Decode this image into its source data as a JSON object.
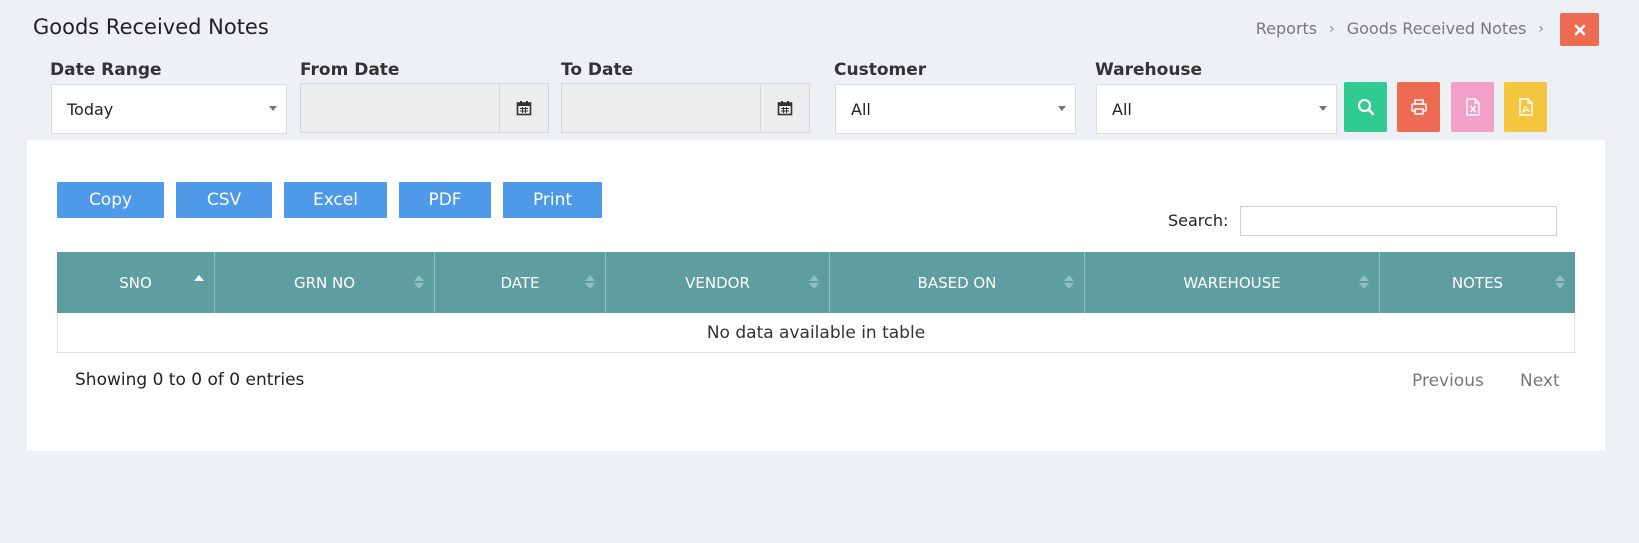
{
  "header": {
    "title": "Goods Received Notes",
    "breadcrumb": [
      "Reports",
      "Goods Received Notes"
    ],
    "breadcrumb_sep": "›"
  },
  "filters": {
    "date_range": {
      "label": "Date Range",
      "value": "Today"
    },
    "from_date": {
      "label": "From Date",
      "value": ""
    },
    "to_date": {
      "label": "To Date",
      "value": ""
    },
    "customer": {
      "label": "Customer",
      "value": "All"
    },
    "warehouse": {
      "label": "Warehouse",
      "value": "All"
    }
  },
  "actions": {
    "search_icon": "search-icon",
    "print_icon": "printer-icon",
    "excel_icon": "excel-file-icon",
    "pdf_icon": "pdf-file-icon"
  },
  "colors": {
    "close": "#ef6a52",
    "search": "#2fcb93",
    "print": "#ef6a52",
    "excel": "#f2a0c8",
    "pdf": "#f4c63f",
    "export": "#4f9ae8",
    "table_head": "#5f9ea0"
  },
  "toolbar": {
    "buttons": [
      "Copy",
      "CSV",
      "Excel",
      "PDF",
      "Print"
    ],
    "search_label": "Search:"
  },
  "table": {
    "columns": [
      "SNO",
      "GRN NO",
      "DATE",
      "VENDOR",
      "BASED ON",
      "WAREHOUSE",
      "NOTES"
    ],
    "empty_text": "No data available in table"
  },
  "footer": {
    "info": "Showing 0 to 0 of 0 entries",
    "previous": "Previous",
    "next": "Next"
  }
}
